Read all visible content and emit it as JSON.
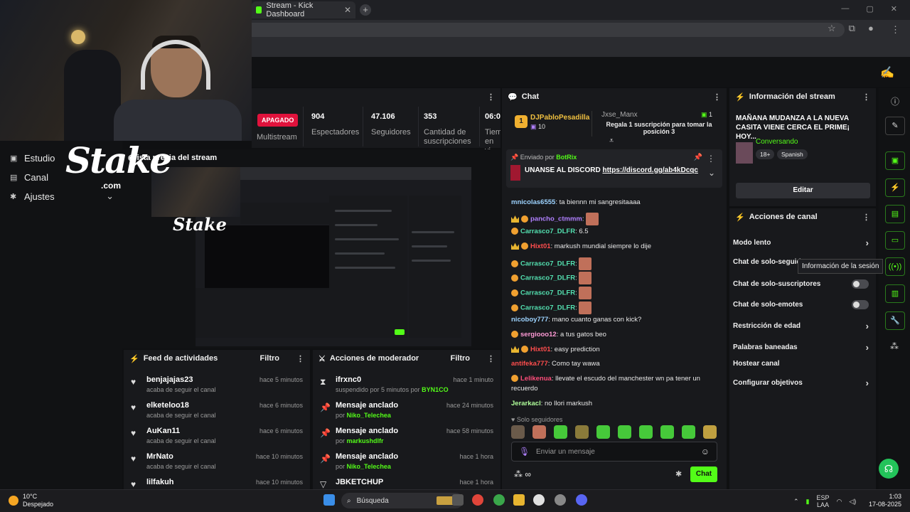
{
  "browser": {
    "tab_title": "Stream - Kick Dashboard",
    "tab_close": "✕",
    "new_tab": "+",
    "window_controls": [
      "—",
      "▢",
      "✕"
    ]
  },
  "webcam": {},
  "overlay": {
    "logo": "Stake",
    "logo_sub": ".com"
  },
  "leftnav": {
    "items": [
      {
        "label": "Estudio",
        "icon": "camera-icon"
      },
      {
        "label": "Canal",
        "icon": "channel-icon"
      },
      {
        "label": "Ajustes",
        "icon": "gear-icon"
      }
    ],
    "ajustes_chevron": "⌄"
  },
  "stats": {
    "status": "APAGADO",
    "multistream": "Multistream",
    "items": [
      {
        "value": "904",
        "label": "Espectadores"
      },
      {
        "value": "47.106",
        "label": "Seguidores"
      },
      {
        "value": "353",
        "label": "Cantidad de suscripciones"
      },
      {
        "value": "06:0",
        "label": "Tiem en vi"
      }
    ]
  },
  "preview": {
    "title": "ista previa del stream"
  },
  "feed": {
    "title": "Feed de actividades",
    "filter": "Filtro",
    "items": [
      {
        "name": "benjajajas23",
        "sub": "acaba de seguir el canal",
        "time": "hace 5 minutos"
      },
      {
        "name": "elketeloo18",
        "sub": "acaba de seguir el canal",
        "time": "hace 6 minutos"
      },
      {
        "name": "AuKan11",
        "sub": "acaba de seguir el canal",
        "time": "hace 6 minutos"
      },
      {
        "name": "MrNato",
        "sub": "acaba de seguir el canal",
        "time": "hace 10 minutos"
      },
      {
        "name": "lilfakuh",
        "sub": "",
        "time": "hace 10 minutos"
      }
    ]
  },
  "mod": {
    "title": "Acciones de moderador",
    "filter": "Filtro",
    "items": [
      {
        "name": "ifrxnc0",
        "sub_prefix": "suspendido por 5 minutos por ",
        "sub_user": "BYN1CO",
        "time": "hace 1 minuto",
        "icon": "hourglass-icon"
      },
      {
        "name": "Mensaje anclado",
        "sub_prefix": "por ",
        "sub_user": "Niko_Telechea",
        "time": "hace 24 minutos",
        "icon": "pin-icon"
      },
      {
        "name": "Mensaje anclado",
        "sub_prefix": "por ",
        "sub_user": "markushdlfr",
        "time": "hace 58 minutos",
        "icon": "pin-icon"
      },
      {
        "name": "Mensaje anclado",
        "sub_prefix": "por ",
        "sub_user": "Niko_Telechea",
        "time": "hace 1 hora",
        "icon": "pin-icon"
      },
      {
        "name": "JBKETCHUP",
        "sub_prefix": "",
        "sub_user": "",
        "time": "hace 1 hora",
        "icon": "chevron-down-icon"
      }
    ]
  },
  "chat": {
    "title": "Chat",
    "gift": {
      "rank": "1",
      "user": "DJPabloPesadilla",
      "count": "10",
      "gifter": "Jxse_Manx",
      "gifter_count": "1",
      "text": "Regala 1 suscripción para tomar la posición 3"
    },
    "pinned": {
      "sent_by": "Enviado por",
      "bot": "BotRix",
      "text": "UNANSE AL DISCORD",
      "link": "https://discord.gg/ab4kDcqc"
    },
    "messages": [
      {
        "user": "mnicolas6555",
        "color": "#9dd3ff",
        "text": ": ta biennn mi sangresitaaaa"
      },
      {
        "user": "pancho_ctmmm",
        "color": "#b080ff",
        "text": ":"
      },
      {
        "user": "Carrasco7_DLFR",
        "color": "#53e0b0",
        "text": ": 6.5"
      },
      {
        "user": "Hixt01",
        "color": "#ff4d4d",
        "text": ": markush mundial siempre lo dije"
      },
      {
        "user": "Carrasco7_DLFR",
        "color": "#53e0b0",
        "text": ":"
      },
      {
        "user": "Carrasco7_DLFR",
        "color": "#53e0b0",
        "text": ":"
      },
      {
        "user": "Carrasco7_DLFR",
        "color": "#53e0b0",
        "text": ":"
      },
      {
        "user": "Carrasco7_DLFR",
        "color": "#53e0b0",
        "text": ":"
      },
      {
        "user": "nicoboy777",
        "color": "#9dd3ff",
        "text": ": mano cuanto ganas con kick?"
      },
      {
        "user": "sergiooo12",
        "color": "#ff9ad5",
        "text": ": a tus gatos beo"
      },
      {
        "user": "Hixt01",
        "color": "#ff4d4d",
        "text": ": easy prediction"
      },
      {
        "user": "antifeka777",
        "color": "#ff4d4d",
        "text": ": Como tay wawa"
      },
      {
        "user": "Lelikenua",
        "color": "#ff4d7a",
        "text": ": llevate el escudo del manchester wn pa tener un"
      },
      {
        "user": "",
        "color": "#e8e8e8",
        "text": "recuerdo"
      },
      {
        "user": "Jerarkacl",
        "color": "#b0ff9a",
        "text": ": no llori markush"
      }
    ],
    "followers_only": "Solo seguidores",
    "input_placeholder": "Enviar un mensaje",
    "send": "Chat"
  },
  "info": {
    "title": "Información del stream",
    "stream_title": "MAÑANA MUDANZA A LA NUEVA CASITA VIENE CERCA EL PRIME¡ HOY...",
    "category": "Conversando",
    "tags": [
      "18+",
      "Spanish"
    ],
    "edit": "Editar"
  },
  "actions": {
    "title": "Acciones de canal",
    "rows": [
      {
        "label": "Modo lento",
        "kind": "chev"
      },
      {
        "label": "Chat de solo-seguid",
        "kind": "none"
      },
      {
        "label": "Chat de solo-suscriptores",
        "kind": "toggle"
      },
      {
        "label": "Chat de solo-emotes",
        "kind": "toggle"
      },
      {
        "label": "Restricción de edad",
        "kind": "chev"
      },
      {
        "label": "Palabras baneadas",
        "kind": "chev"
      },
      {
        "label": "Hostear canal",
        "kind": "none"
      },
      {
        "label": "Configurar objetivos",
        "kind": "chev"
      }
    ]
  },
  "rail": {
    "tooltip": "Información de la sesión"
  },
  "taskbar": {
    "temp": "10°C",
    "weather": "Despejado",
    "search": "Búsqueda",
    "lang": "ESP",
    "lang2": "LAA",
    "time": "1:03",
    "date": "17-08-2025"
  },
  "colors": {
    "kick_green": "#53fc18",
    "apagado": "#e0123c"
  }
}
